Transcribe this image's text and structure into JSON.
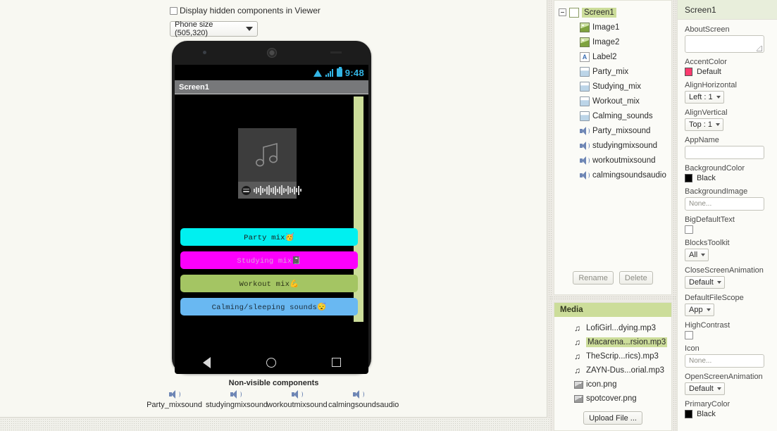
{
  "viewer": {
    "hidden_components_label": "Display hidden components in Viewer",
    "phone_size_label": "Phone size (505,320)",
    "nonvisible_title": "Non-visible components",
    "nonvisible_items": [
      {
        "label": "Party_mixsound",
        "icon": "speaker-icon"
      },
      {
        "label": "studyingmixsound",
        "icon": "speaker-icon"
      },
      {
        "label": "workoutmixsound",
        "icon": "speaker-icon"
      },
      {
        "label": "calmingsoundsaudio",
        "icon": "speaker-icon"
      }
    ]
  },
  "phone": {
    "status_time": "9:48",
    "status_icons": [
      "wifi-icon",
      "signal-icon",
      "battery-icon"
    ],
    "title_bar": "Screen1",
    "album_art": {
      "icon": "music-note-icon",
      "badge_icon": "spotify-code-icon"
    },
    "buttons": [
      {
        "text": "Party mix🥳",
        "bg": "#00f0f0",
        "fg": "#1a1a1a"
      },
      {
        "text": "Studying mix📓",
        "bg": "#fc00fc",
        "fg": "#d9a8d9"
      },
      {
        "text": "Workout mix💪",
        "bg": "#a4c563",
        "fg": "#2c3418"
      },
      {
        "text": "Calming/sleeping sounds😴",
        "bg": "#69b8f2",
        "fg": "#1a2c3a"
      }
    ],
    "nav_icons": [
      "back-icon",
      "home-icon",
      "recents-icon"
    ]
  },
  "components": {
    "tree": [
      {
        "label": "Screen1",
        "icon": "screen-icon",
        "depth": 0,
        "selected": true
      },
      {
        "label": "Image1",
        "icon": "image-icon",
        "depth": 1,
        "selected": false
      },
      {
        "label": "Image2",
        "icon": "image-icon",
        "depth": 1,
        "selected": false
      },
      {
        "label": "Label2",
        "icon": "label-icon",
        "depth": 1,
        "selected": false
      },
      {
        "label": "Party_mix",
        "icon": "button-icon",
        "depth": 1,
        "selected": false
      },
      {
        "label": "Studying_mix",
        "icon": "button-icon",
        "depth": 1,
        "selected": false
      },
      {
        "label": "Workout_mix",
        "icon": "button-icon",
        "depth": 1,
        "selected": false
      },
      {
        "label": "Calming_sounds",
        "icon": "button-icon",
        "depth": 1,
        "selected": false
      },
      {
        "label": "Party_mixsound",
        "icon": "sound-icon",
        "depth": 1,
        "selected": false
      },
      {
        "label": "studyingmixsound",
        "icon": "sound-icon",
        "depth": 1,
        "selected": false
      },
      {
        "label": "workoutmixsound",
        "icon": "sound-icon",
        "depth": 1,
        "selected": false
      },
      {
        "label": "calmingsoundsaudio",
        "icon": "sound-icon",
        "depth": 1,
        "selected": false
      }
    ],
    "rename_label": "Rename",
    "delete_label": "Delete"
  },
  "media": {
    "header": "Media",
    "items": [
      {
        "label": "LofiGirl...dying.mp3",
        "icon": "mp3-icon",
        "selected": false
      },
      {
        "label": "Macarena...rsion.mp3",
        "icon": "mp3-icon",
        "selected": true
      },
      {
        "label": "TheScrip...rics).mp3",
        "icon": "mp3-icon",
        "selected": false
      },
      {
        "label": "ZAYN-Dus...orial.mp3",
        "icon": "mp3-icon",
        "selected": false
      },
      {
        "label": "icon.png",
        "icon": "png-icon",
        "selected": false
      },
      {
        "label": "spotcover.png",
        "icon": "png-icon",
        "selected": false
      }
    ],
    "upload_label": "Upload File ..."
  },
  "properties": {
    "header": "Screen1",
    "items": [
      {
        "name": "AboutScreen",
        "type": "textarea",
        "value": ""
      },
      {
        "name": "AccentColor",
        "type": "color",
        "value": "Default",
        "swatch": "#fc3a6e"
      },
      {
        "name": "AlignHorizontal",
        "type": "select",
        "value": "Left : 1"
      },
      {
        "name": "AlignVertical",
        "type": "select",
        "value": "Top : 1"
      },
      {
        "name": "AppName",
        "type": "input",
        "value": ""
      },
      {
        "name": "BackgroundColor",
        "type": "color",
        "value": "Black",
        "swatch": "#000000"
      },
      {
        "name": "BackgroundImage",
        "type": "input",
        "value": "None..."
      },
      {
        "name": "BigDefaultText",
        "type": "checkbox",
        "value": ""
      },
      {
        "name": "BlocksToolkit",
        "type": "select",
        "value": "All"
      },
      {
        "name": "CloseScreenAnimation",
        "type": "select",
        "value": "Default"
      },
      {
        "name": "DefaultFileScope",
        "type": "select",
        "value": "App"
      },
      {
        "name": "HighContrast",
        "type": "checkbox",
        "value": ""
      },
      {
        "name": "Icon",
        "type": "input",
        "value": "None..."
      },
      {
        "name": "OpenScreenAnimation",
        "type": "select",
        "value": "Default"
      },
      {
        "name": "PrimaryColor",
        "type": "color",
        "value": "Black",
        "swatch": "#000000"
      }
    ]
  }
}
